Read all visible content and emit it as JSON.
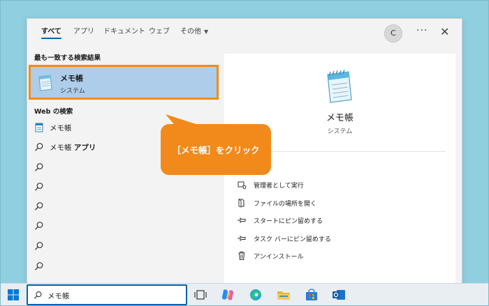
{
  "tabs": [
    {
      "label": "すべて",
      "active": true
    },
    {
      "label": "アプリ"
    },
    {
      "label": "ドキュメント"
    },
    {
      "label": "ウェブ"
    },
    {
      "label": "その他",
      "has_dropdown": true
    }
  ],
  "header": {
    "avatar_initial": "C",
    "more_label": "···",
    "close_label": "✕"
  },
  "best_match": {
    "section_title": "最も一致する検索結果",
    "name": "メモ帳",
    "subtitle": "システム",
    "icon": "notepad-icon"
  },
  "web_search": {
    "section_title": "Web の検索",
    "results": [
      {
        "text": "メモ帳",
        "bold_suffix": "",
        "icon": "notepad-icon"
      },
      {
        "text": "メモ帳 ",
        "bold_suffix": "アプリ",
        "icon": "search-icon"
      },
      {
        "text": "",
        "bold_suffix": "",
        "icon": "search-icon"
      },
      {
        "text": "",
        "bold_suffix": "",
        "icon": "search-icon"
      },
      {
        "text": "",
        "bold_suffix": "",
        "icon": "search-icon"
      },
      {
        "text": "",
        "bold_suffix": "",
        "icon": "search-icon"
      },
      {
        "text": "",
        "bold_suffix": "",
        "icon": "search-icon"
      },
      {
        "text": "",
        "bold_suffix": "",
        "icon": "search-icon"
      }
    ]
  },
  "detail": {
    "name": "メモ帳",
    "subtitle": "システム",
    "actions": [
      {
        "label": "管理者として実行",
        "icon": "shield-run-icon"
      },
      {
        "label": "ファイルの場所を開く",
        "icon": "folder-open-icon"
      },
      {
        "label": "スタートにピン留めする",
        "icon": "pin-icon"
      },
      {
        "label": "タスク バーにピン留めする",
        "icon": "pin-icon"
      },
      {
        "label": "アンインストール",
        "icon": "trash-icon"
      }
    ]
  },
  "callout": {
    "text": "［メモ帳］をクリック"
  },
  "taskbar": {
    "search_value": "メモ帳",
    "icons": [
      "task-view-icon",
      "copilot-icon",
      "edge-icon",
      "file-explorer-icon",
      "store-icon",
      "outlook-icon"
    ]
  },
  "colors": {
    "accent": "#0063b1",
    "highlight_border": "#f08c16",
    "callout": "#f18a1a",
    "selected_bg": "#aecdea",
    "desktop_bg": "#8fcfe0"
  }
}
